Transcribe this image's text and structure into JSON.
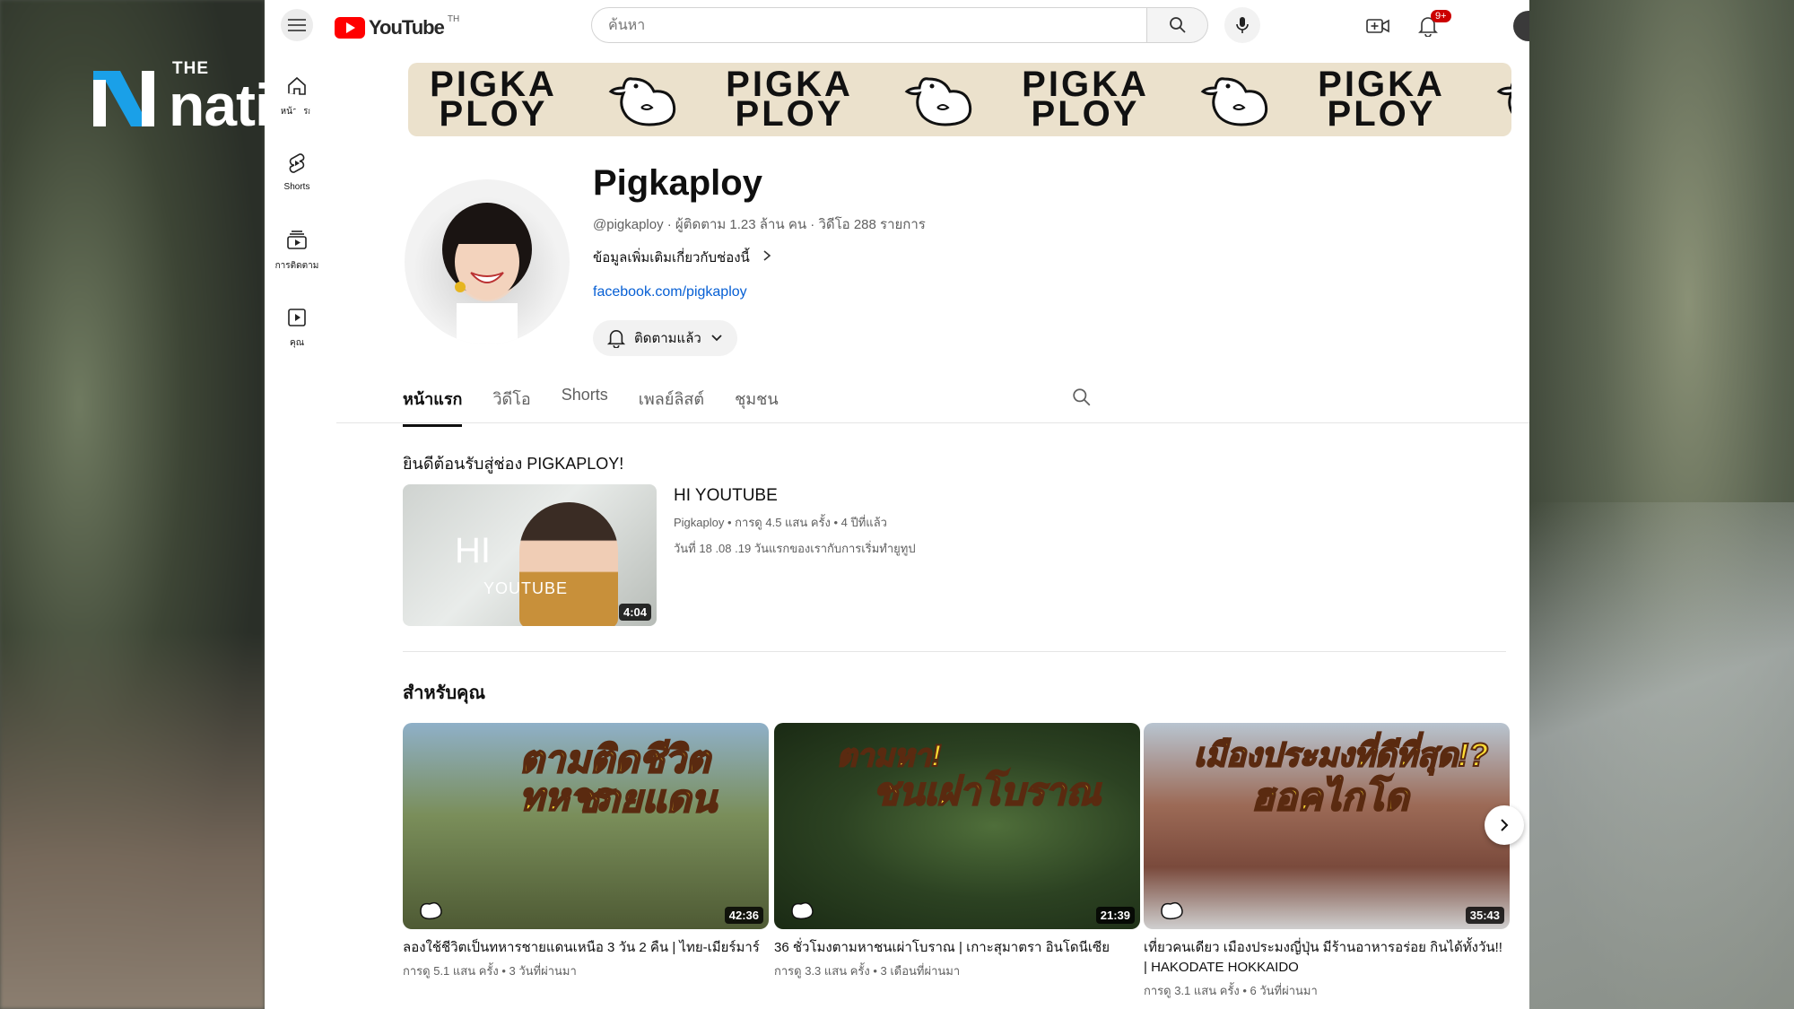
{
  "overlay": {
    "logo_the": "THE",
    "logo_word": "nation"
  },
  "topbar": {
    "yt_word": "YouTube",
    "yt_region": "TH",
    "search_placeholder": "ค้นหา",
    "notif_count": "9+"
  },
  "rail": {
    "items": [
      {
        "label": "หน้าแรก",
        "icon": "home-icon"
      },
      {
        "label": "Shorts",
        "icon": "shorts-icon"
      },
      {
        "label": "การติดตาม",
        "icon": "subscriptions-icon"
      },
      {
        "label": "คุณ",
        "icon": "you-icon"
      }
    ]
  },
  "banner": {
    "text_line1": "PIGKA",
    "text_line2": "PLOY"
  },
  "channel": {
    "name": "Pigkaploy",
    "meta": "@pigkaploy · ผู้ติดตาม 1.23 ล้าน คน · วิดีโอ 288 รายการ",
    "more": "ข้อมูลเพิ่มเติมเกี่ยวกับช่องนี้",
    "link": "facebook.com/pigkaploy",
    "subscribed_label": "ติดตามแล้ว"
  },
  "tabs": [
    "หน้าแรก",
    "วิดีโอ",
    "Shorts",
    "เพลย์ลิสต์",
    "ชุมชน"
  ],
  "featured": {
    "section_title": "ยินดีต้อนรับสู่ช่อง PIGKAPLOY!",
    "title": "HI YOUTUBE",
    "meta": "Pigkaploy • การดู 4.5 แสน ครั้ง • 4 ปีที่แล้ว",
    "desc": "วันที่ 18 .08 .19 วันแรกของเรากับการเริ่มทำยูทูป",
    "thumb_hi": "HI",
    "thumb_yt": "YOUTUBE",
    "duration": "4:04"
  },
  "for_you": {
    "section_title": "สำหรับคุณ",
    "videos": [
      {
        "title": "ลองใช้ชีวิตเป็นทหารชายแดนเหนือ 3 วัน 2 คืน | ไทย-เมียร์มาร์",
        "meta": "การดู 5.1 แสน ครั้ง • 3 วันที่ผ่านมา",
        "duration": "42:36",
        "thumb_text1": "ตามติดชีวิตทหาร",
        "thumb_text2": "ชายแดน",
        "bg": "#6c7a4a"
      },
      {
        "title": "36 ชั่วโมงตามหาชนเผ่าโบราณ | เกาะสุมาตรา อินโดนีเซีย",
        "meta": "การดู 3.3 แสน ครั้ง • 3 เดือนที่ผ่านมา",
        "duration": "21:39",
        "thumb_text1": "ตามหา!",
        "thumb_text2": "ชนเผ่าโบราณ",
        "bg": "#2e4a26"
      },
      {
        "title": "เที่ยวคนเดียว เมืองประมงญี่ปุ่น มีร้านอาหารอร่อย กินได้ทั้งวัน!! | HAKODATE HOKKAIDO",
        "meta": "การดู 3.1 แสน ครั้ง • 6 วันที่ผ่านมา",
        "duration": "35:43",
        "thumb_text1": "เมืองประมงที่ดีที่สุด!?",
        "thumb_text2": "ฮอคไกโด",
        "bg": "#8a5a48"
      }
    ]
  }
}
